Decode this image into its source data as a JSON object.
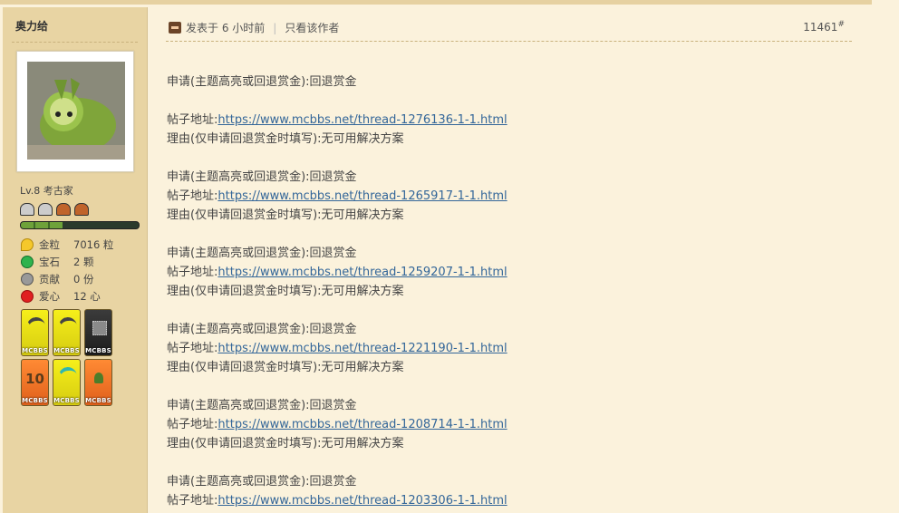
{
  "sidebar": {
    "username": "奥力给",
    "level": "Lv.8 考古家",
    "exp_progress": 0.35,
    "stats": [
      {
        "icon": "gold-nugget-icon",
        "label": "金粒",
        "value": "7016 粒"
      },
      {
        "icon": "gem-icon",
        "label": "宝石",
        "value": "2 颗"
      },
      {
        "icon": "contribution-icon",
        "label": "贡献",
        "value": "0 份"
      },
      {
        "icon": "apple-heart-icon",
        "label": "爱心",
        "value": "12 心"
      }
    ],
    "medal_label": "MCBBS",
    "medals": [
      {
        "icon": "gold-pickaxe-medal",
        "color": "yellow",
        "glyph": ""
      },
      {
        "icon": "gold-pickaxe-medal",
        "color": "yellow",
        "glyph": ""
      },
      {
        "icon": "ore-block-medal",
        "color": "black",
        "glyph": ""
      },
      {
        "icon": "ten-anniversary-medal",
        "color": "orange",
        "glyph": "10"
      },
      {
        "icon": "diamond-pickaxe-medal",
        "color": "yellow",
        "glyph": ""
      },
      {
        "icon": "plant-medal",
        "color": "orange",
        "glyph": ""
      }
    ]
  },
  "post": {
    "posted": "发表于 6 小时前",
    "only_author": "只看该作者",
    "floor_number": "11461",
    "floor_symbol": "#",
    "entries": [
      {
        "type": "申请(主题高亮或回退赏金):回退赏金",
        "addr_label": "帖子地址:",
        "url": "https://www.mcbbs.net/thread-1276136-1-1.html",
        "reason": "理由(仅申请回退赏金时填写):无可用解决方案",
        "blank_after_type": true
      },
      {
        "type": "申请(主题高亮或回退赏金):回退赏金",
        "addr_label": "帖子地址:",
        "url": "https://www.mcbbs.net/thread-1265917-1-1.html",
        "reason": "理由(仅申请回退赏金时填写):无可用解决方案",
        "blank_after_type": false
      },
      {
        "type": "申请(主题高亮或回退赏金):回退赏金",
        "addr_label": "帖子地址:",
        "url": "https://www.mcbbs.net/thread-1259207-1-1.html",
        "reason": "理由(仅申请回退赏金时填写):无可用解决方案",
        "blank_after_type": false
      },
      {
        "type": "申请(主题高亮或回退赏金):回退赏金",
        "addr_label": "帖子地址:",
        "url": "https://www.mcbbs.net/thread-1221190-1-1.html",
        "reason": "理由(仅申请回退赏金时填写):无可用解决方案",
        "blank_after_type": false
      },
      {
        "type": "申请(主题高亮或回退赏金):回退赏金",
        "addr_label": "帖子地址:",
        "url": "https://www.mcbbs.net/thread-1208714-1-1.html",
        "reason": "理由(仅申请回退赏金时填写):无可用解决方案",
        "blank_after_type": false
      },
      {
        "type": "申请(主题高亮或回退赏金):回退赏金",
        "addr_label": "帖子地址:",
        "url": "https://www.mcbbs.net/thread-1203306-1-1.html",
        "reason": "",
        "blank_after_type": false
      }
    ]
  }
}
